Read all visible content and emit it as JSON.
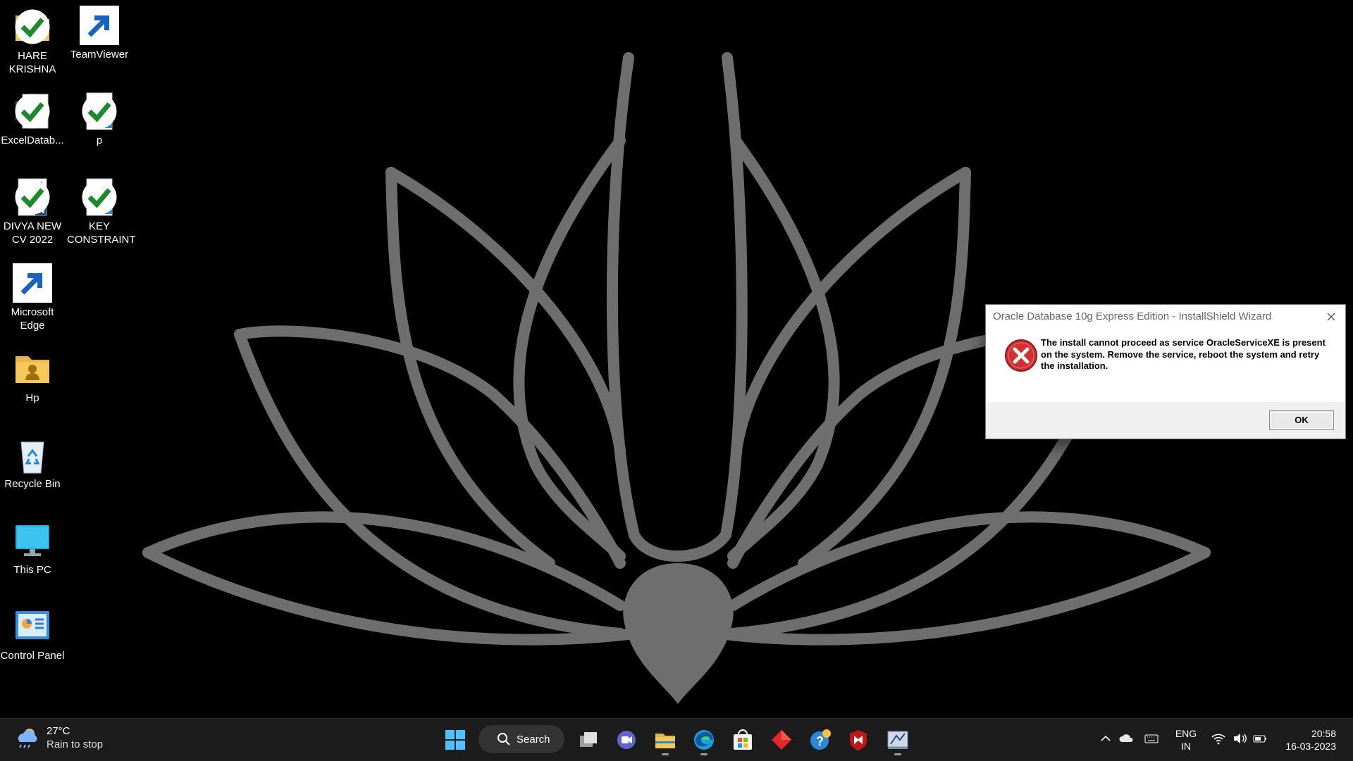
{
  "desktop": {
    "icons": [
      {
        "label": "HARE KRISHNA",
        "icon": "folder-icon"
      },
      {
        "label": "TeamViewer",
        "icon": "teamviewer-icon"
      },
      {
        "label": "ExcelDatab...",
        "icon": "excel-icon"
      },
      {
        "label": "p",
        "icon": "text-document-icon"
      },
      {
        "label": "DIVYA NEW CV 2022",
        "icon": "word-document-icon"
      },
      {
        "label": "KEY CONSTRAINT",
        "icon": "text-document-icon"
      },
      {
        "label": "Microsoft Edge",
        "icon": "edge-icon"
      },
      {
        "label": "Hp",
        "icon": "user-folder-icon"
      },
      {
        "label": "Recycle Bin",
        "icon": "recycle-bin-icon"
      },
      {
        "label": "This PC",
        "icon": "monitor-icon"
      },
      {
        "label": "Control Panel",
        "icon": "control-panel-icon"
      }
    ]
  },
  "dialog": {
    "title": "Oracle Database 10g Express Edition - InstallShield Wizard",
    "message": "The install cannot proceed as service OracleServiceXE is present on the system. Remove the service, reboot the system and retry the installation.",
    "ok_label": "OK",
    "icon": "error-icon"
  },
  "taskbar": {
    "weather": {
      "temp": "27°C",
      "condition": "Rain to stop"
    },
    "search_label": "Search",
    "apps": [
      "start-icon",
      "task-view-icon",
      "teams-chat-icon",
      "file-explorer-icon",
      "edge-icon",
      "store-icon",
      "app-red-diamond-icon",
      "help-icon",
      "mcafee-icon",
      "installer-icon"
    ],
    "tray": {
      "lang_1": "ENG",
      "lang_2": "IN",
      "time": "20:58",
      "date": "16-03-2023"
    }
  },
  "colors": {
    "wallpaper_bg": "#000000",
    "lotus": "#6e6e6e",
    "taskbar": "#1c1c1c",
    "error_red": "#d32f2f"
  }
}
